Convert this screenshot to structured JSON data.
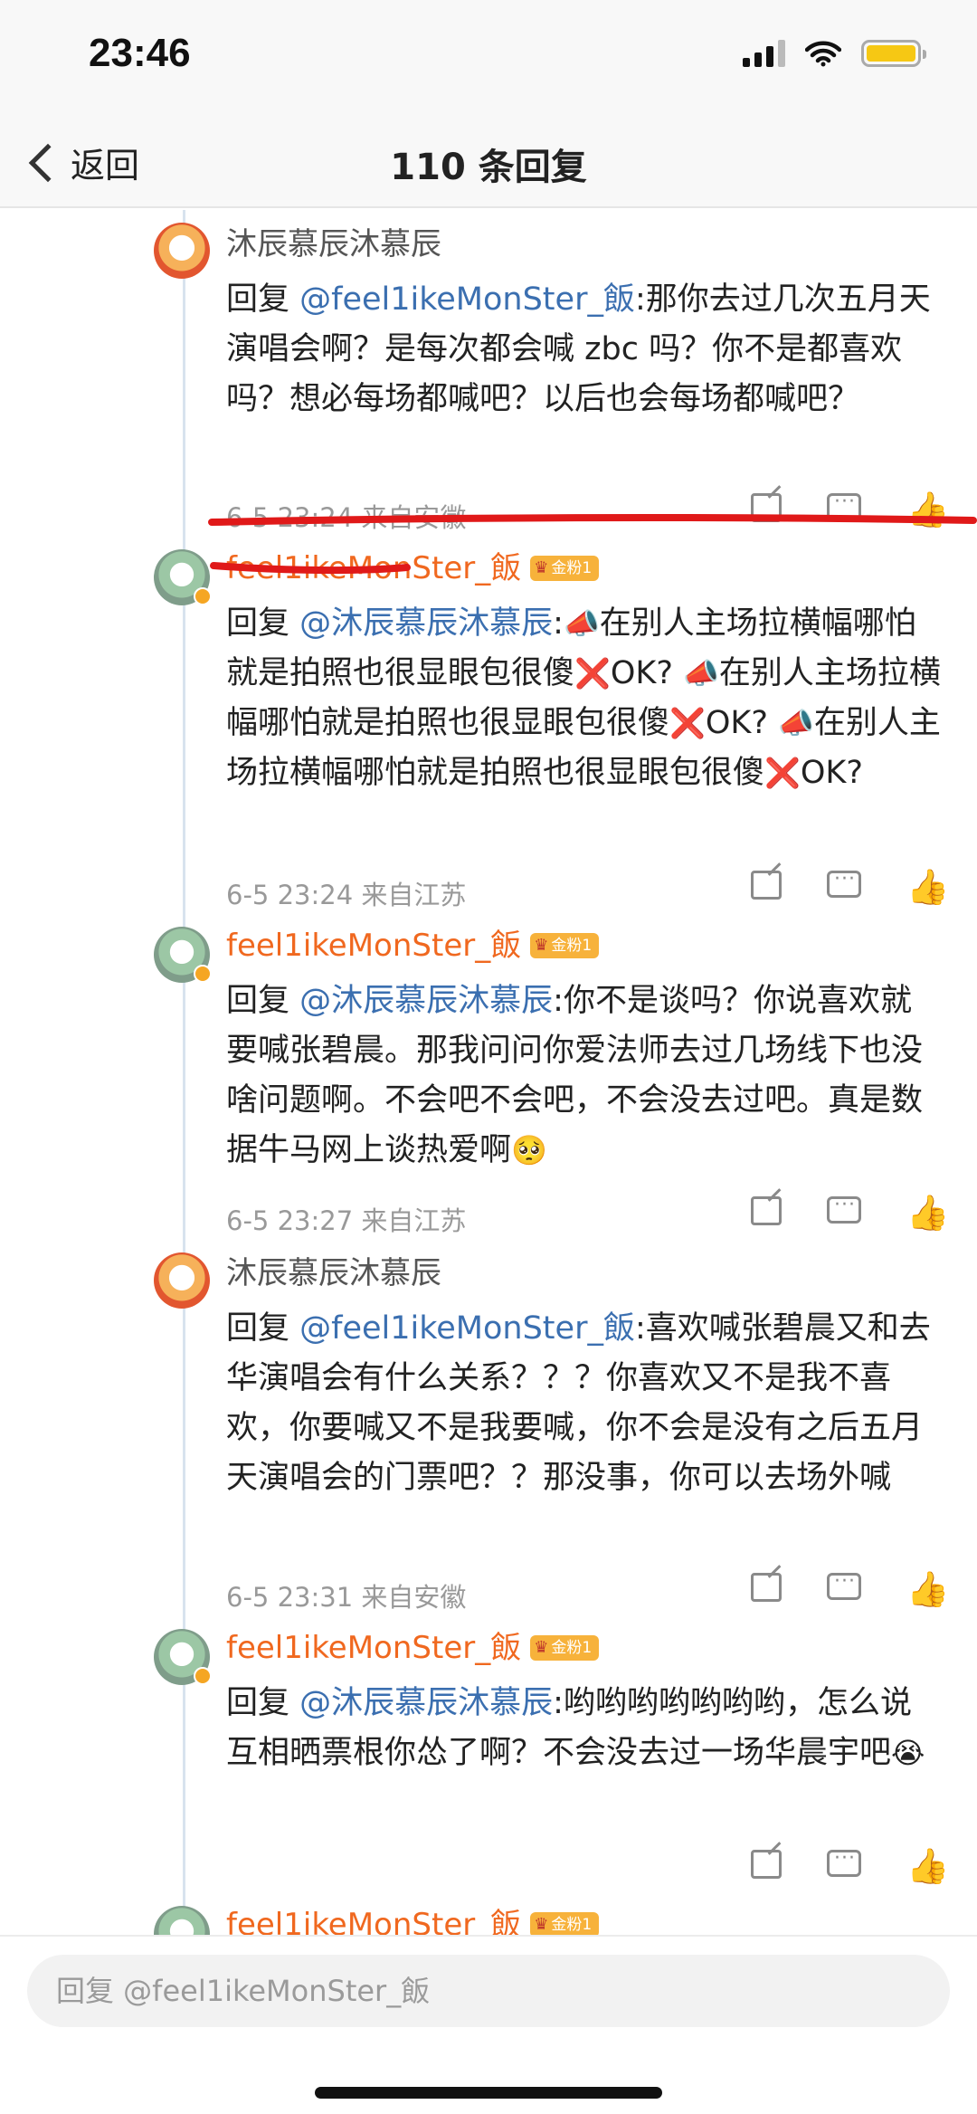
{
  "status_bar": {
    "time": "23:46"
  },
  "nav": {
    "back_label": "返回",
    "title": "110 条回复"
  },
  "comments": [
    {
      "author": "沐辰慕辰沐慕辰",
      "reply_prefix": "回复 ",
      "mention": "@feel1ikeMonSter_飯",
      "text": ":那你去过几次五月天演唱会啊？是每次都会喊 zbc 吗？你不是都喜欢吗？想必每场都喊吧？以后也会每场都喊吧？",
      "time": "6-5 23:24 来自安徽"
    },
    {
      "author": "feel1ikeMonSter_飯",
      "badge": "金粉1",
      "reply_prefix": "回复 ",
      "mention": "@沐辰慕辰沐慕辰",
      "segments": [
        ":",
        "📣",
        "在别人主场拉横幅哪怕就是拍照也很显眼包很傻",
        "❌",
        "OK? ",
        "📣",
        "在别人主场拉横幅哪怕就是拍照也很显眼包很傻",
        "❌",
        "OK? ",
        "📣",
        "在别人主场拉横幅哪怕就是拍照也很显眼包很傻",
        "❌",
        "OK?"
      ],
      "time": "6-5 23:24 来自江苏"
    },
    {
      "author": "feel1ikeMonSter_飯",
      "badge": "金粉1",
      "reply_prefix": "回复 ",
      "mention": "@沐辰慕辰沐慕辰",
      "text": ":你不是谈吗？你说喜欢就要喊张碧晨。那我问问你爱法师去过几场线下也没啥问题啊。不会吧不会吧，不会没去过吧。真是数据牛马网上谈热爱啊",
      "emoji": "🥺",
      "time": "6-5 23:27 来自江苏"
    },
    {
      "author": "沐辰慕辰沐慕辰",
      "reply_prefix": "回复 ",
      "mention": "@feel1ikeMonSter_飯",
      "text": ":喜欢喊张碧晨又和去华演唱会有什么关系？？？你喜欢又不是我不喜欢，你要喊又不是我要喊，你不会是没有之后五月天演唱会的门票吧？？那没事，你可以去场外喊",
      "time": "6-5 23:31 来自安徽"
    },
    {
      "author": "feel1ikeMonSter_飯",
      "badge": "金粉1",
      "reply_prefix": "回复 ",
      "mention": "@沐辰慕辰沐慕辰",
      "text": ":哟哟哟哟哟哟哟，怎么说互相晒票根你怂了啊？不会没去过一场华晨宇吧",
      "emoji": "😭",
      "time": ""
    },
    {
      "author": "feel1ikeMonSter_飯",
      "badge": "金粉1"
    }
  ],
  "icons": [
    "share-icon",
    "comment-icon",
    "like-icon",
    "back-chevron-icon",
    "signal-icon",
    "wifi-icon",
    "battery-icon"
  ],
  "colors": {
    "mention": "#3b6fb0",
    "author_gold": "#f0681f",
    "badge": "#f7b23b",
    "battery": "#f6c814",
    "annotation": "#e01919"
  },
  "reply_bar": {
    "placeholder": "回复 @feel1ikeMonSter_飯"
  }
}
